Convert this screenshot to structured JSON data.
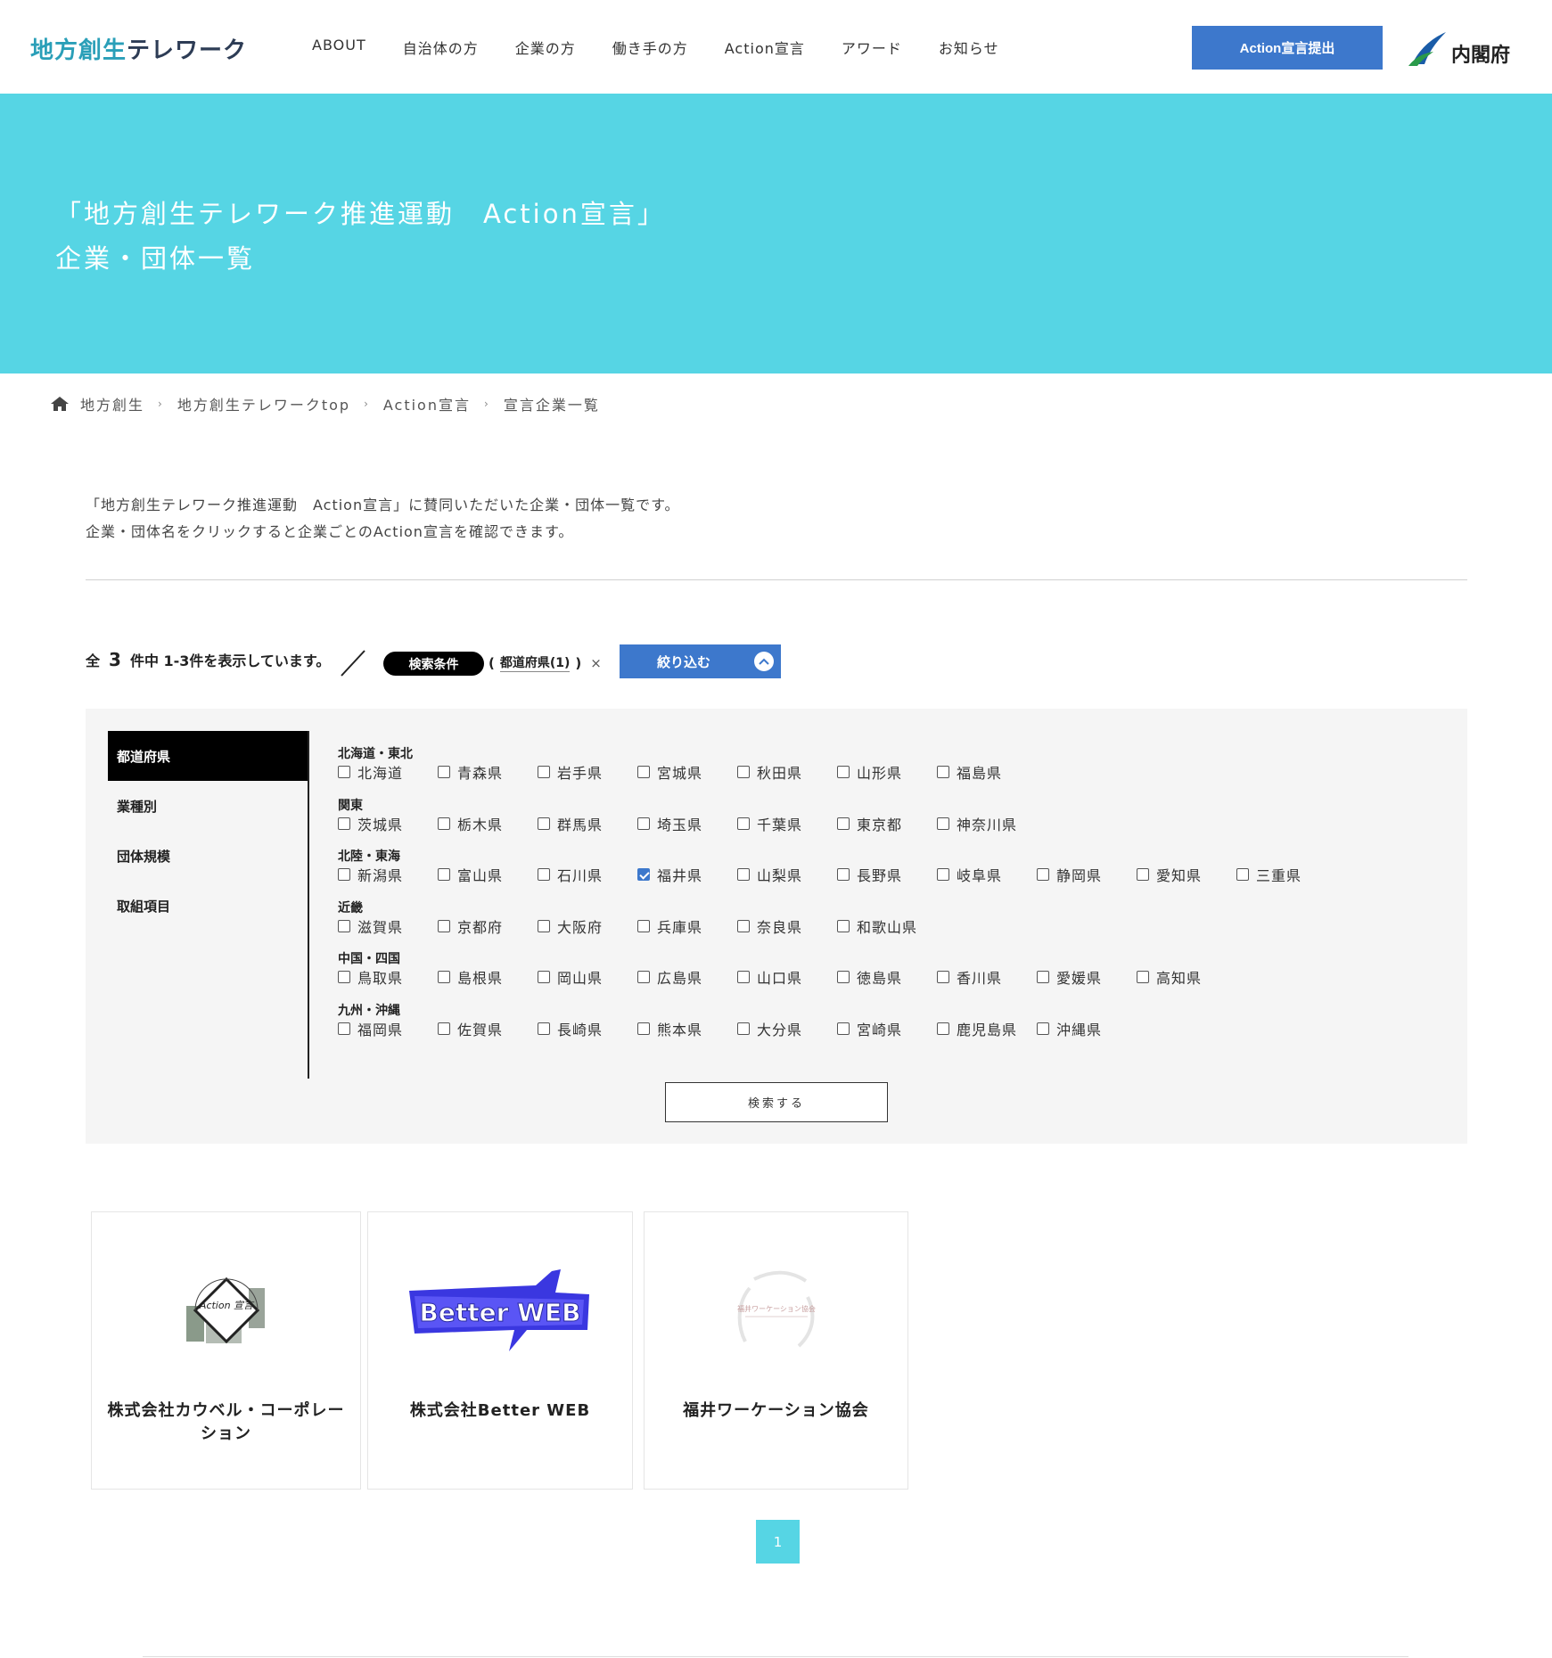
{
  "header": {
    "logo_part1": "地方創生",
    "logo_part2": "テレワーク",
    "nav": [
      "ABOUT",
      "自治体の方",
      "企業の方",
      "働き手の方",
      "Action宣言",
      "アワード",
      "お知らせ"
    ],
    "cta_label": "Action宣言提出",
    "cabinet_label": "内閣府"
  },
  "hero": {
    "title_line1": "「地方創生テレワーク推進運動　Action宣言」",
    "title_line2": "企業・団体一覧"
  },
  "breadcrumb": [
    "地方創生",
    "地方創生テレワークtop",
    "Action宣言",
    "宣言企業一覧"
  ],
  "intro": {
    "line1": "「地方創生テレワーク推進運動　Action宣言」に賛同いただいた企業・団体一覧です。",
    "line2": "企業・団体名をクリックすると企業ごとのAction宣言を確認できます。"
  },
  "results": {
    "prefix": "全",
    "count": "3",
    "suffix": "件中 1-3件を表示しています。",
    "condition_label": "検索条件",
    "condition_open": "(",
    "condition_value": "都道府県(1)",
    "condition_close": ")",
    "clear": "×",
    "filter_button": "絞り込む"
  },
  "filter": {
    "tabs": [
      "都道府県",
      "業種別",
      "団体規模",
      "取組項目"
    ],
    "regions": [
      {
        "name": "北海道・東北",
        "prefs": [
          "北海道",
          "青森県",
          "岩手県",
          "宮城県",
          "秋田県",
          "山形県",
          "福島県"
        ]
      },
      {
        "name": "関東",
        "prefs": [
          "茨城県",
          "栃木県",
          "群馬県",
          "埼玉県",
          "千葉県",
          "東京都",
          "神奈川県"
        ]
      },
      {
        "name": "北陸・東海",
        "prefs": [
          "新潟県",
          "富山県",
          "石川県",
          "福井県",
          "山梨県",
          "長野県",
          "岐阜県",
          "静岡県",
          "愛知県",
          "三重県"
        ]
      },
      {
        "name": "近畿",
        "prefs": [
          "滋賀県",
          "京都府",
          "大阪府",
          "兵庫県",
          "奈良県",
          "和歌山県"
        ]
      },
      {
        "name": "中国・四国",
        "prefs": [
          "鳥取県",
          "島根県",
          "岡山県",
          "広島県",
          "山口県",
          "徳島県",
          "香川県",
          "愛媛県",
          "高知県"
        ]
      },
      {
        "name": "九州・沖縄",
        "prefs": [
          "福岡県",
          "佐賀県",
          "長崎県",
          "熊本県",
          "大分県",
          "宮崎県",
          "鹿児島県",
          "沖縄県"
        ]
      }
    ],
    "checked": [
      "福井県"
    ],
    "search_button": "検索する"
  },
  "cards": [
    {
      "name": "株式会社カウベル・コーポレーション",
      "logo_text": "Action 宣言"
    },
    {
      "name": "株式会社Better WEB",
      "logo_text": "Better WEB"
    },
    {
      "name": "福井ワーケーション協会",
      "logo_text": "福井ワーケーション協会"
    }
  ],
  "pagination": {
    "current": "1"
  },
  "colors": {
    "accent": "#56d5e4",
    "button": "#3d78cc"
  }
}
